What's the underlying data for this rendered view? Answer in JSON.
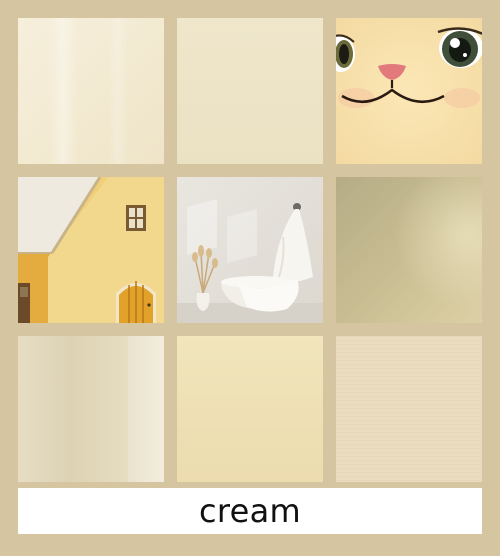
{
  "caption": "cream",
  "tiles": [
    {
      "icon": "plain-cream-texture"
    },
    {
      "icon": "flat-cream-swatch"
    },
    {
      "icon": "cat-face"
    },
    {
      "icon": "yellow-cottage"
    },
    {
      "icon": "bathtub-interior"
    },
    {
      "icon": "olive-gradient"
    },
    {
      "icon": "soft-beige-gradient"
    },
    {
      "icon": "pale-yellow-swatch"
    },
    {
      "icon": "linen-texture"
    }
  ],
  "colors": {
    "background": "#d5c6a1",
    "caption_bg": "#ffffff",
    "caption_text": "#111111"
  }
}
